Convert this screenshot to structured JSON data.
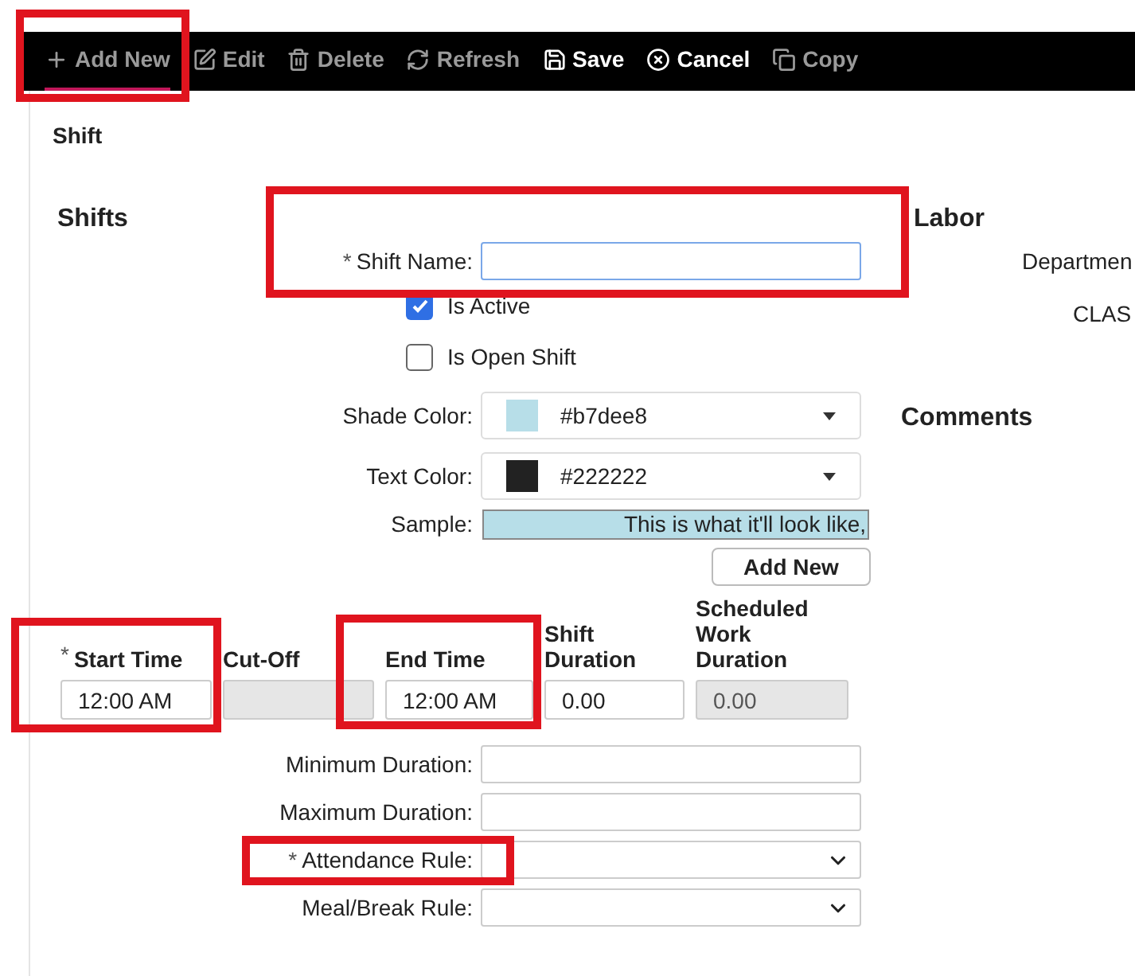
{
  "toolbar": [
    {
      "kind": "add",
      "label": "Add New",
      "disabled": true,
      "selected": true,
      "highlighted": true
    },
    {
      "kind": "edit",
      "label": "Edit",
      "disabled": true,
      "selected": false
    },
    {
      "kind": "delete",
      "label": "Delete",
      "disabled": true,
      "selected": false
    },
    {
      "kind": "refresh",
      "label": "Refresh",
      "disabled": true,
      "selected": false
    },
    {
      "kind": "save",
      "label": "Save",
      "disabled": false,
      "selected": false
    },
    {
      "kind": "cancel",
      "label": "Cancel",
      "disabled": false,
      "selected": false
    },
    {
      "kind": "copy",
      "label": "Copy",
      "disabled": true,
      "selected": false
    }
  ],
  "page_title": "Shift",
  "shifts": {
    "heading": "Shifts",
    "shift_name": {
      "label": "Shift Name:",
      "required_mark": "*",
      "highlighted": true
    },
    "checkboxes": [
      {
        "label": "Is Active",
        "checked": true
      },
      {
        "label": "Is Open Shift",
        "checked": false
      }
    ],
    "shade_color": {
      "label": "Shade Color:",
      "value": "#b7dee8",
      "color": "#b7dee8"
    },
    "text_color": {
      "label": "Text Color:",
      "value": "#222222",
      "color": "#222222"
    },
    "sample": {
      "label": "Sample:",
      "text": "This is what it'll look like,"
    },
    "add_new_button": "Add New",
    "time_columns": [
      {
        "header": "Start Time",
        "required_mark": "*",
        "value": "12:00 AM",
        "disabled": false,
        "highlighted": true
      },
      {
        "header": "Cut-Off",
        "disabled": true
      },
      {
        "header": "End Time",
        "value": "12:00 AM",
        "disabled": false,
        "highlighted": true
      },
      {
        "header": "Shift Duration",
        "value": "0.00",
        "disabled": false
      },
      {
        "header": "Scheduled Work Duration",
        "value": "0.00",
        "disabled": true
      }
    ],
    "fields": [
      {
        "kind": "text",
        "label": "Minimum Duration:"
      },
      {
        "kind": "text",
        "label": "Maximum Duration:"
      },
      {
        "kind": "select",
        "label": "Attendance Rule:",
        "required_mark": "*",
        "highlighted": true
      },
      {
        "kind": "select",
        "label": "Meal/Break Rule:"
      }
    ]
  },
  "labor": {
    "heading": "Labor",
    "items": [
      "Departmen",
      "CLAS"
    ]
  },
  "comments": {
    "heading": "Comments"
  }
}
